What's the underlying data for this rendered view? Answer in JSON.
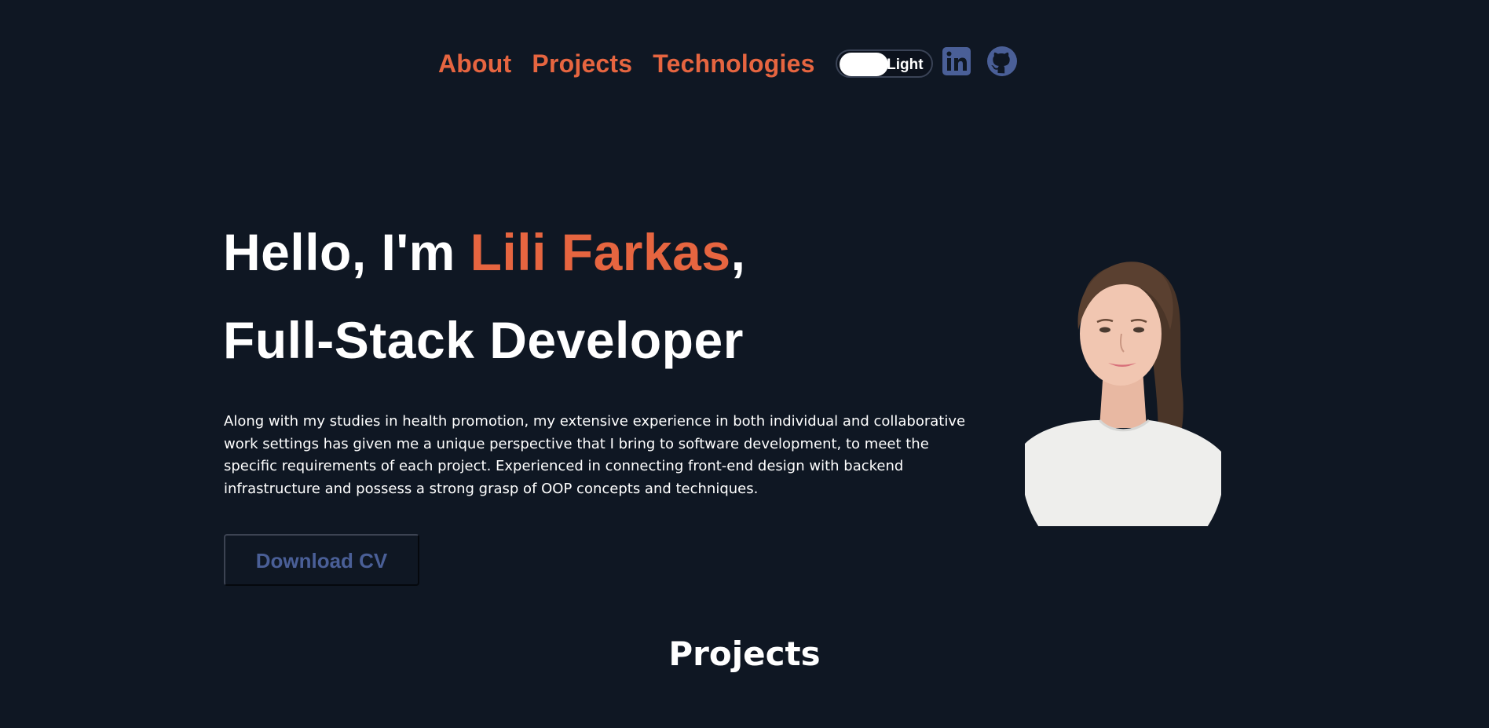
{
  "nav": {
    "items": [
      {
        "label": "About"
      },
      {
        "label": "Projects"
      },
      {
        "label": "Technologies"
      }
    ],
    "theme_toggle_label": "Light",
    "linkedin_icon": "linkedin-icon",
    "github_icon": "github-icon"
  },
  "hero": {
    "greeting": "Hello, I'm ",
    "name": "Lili Farkas",
    "comma": ",",
    "role": "Full-Stack Developer",
    "description": "Along with my studies in health promotion, my extensive experience in both individual and collaborative work settings has given me a unique perspective that I bring to software development, to meet the specific requirements of each project. Experienced in connecting front-end design with backend infrastructure and possess a strong grasp of OOP concepts and techniques.",
    "cv_button_label": "Download CV"
  },
  "projects": {
    "title": "Projects"
  },
  "colors": {
    "background": "#0f1723",
    "accent": "#e66540",
    "button_text": "#4a5f97",
    "icon": "#4a5f97"
  }
}
